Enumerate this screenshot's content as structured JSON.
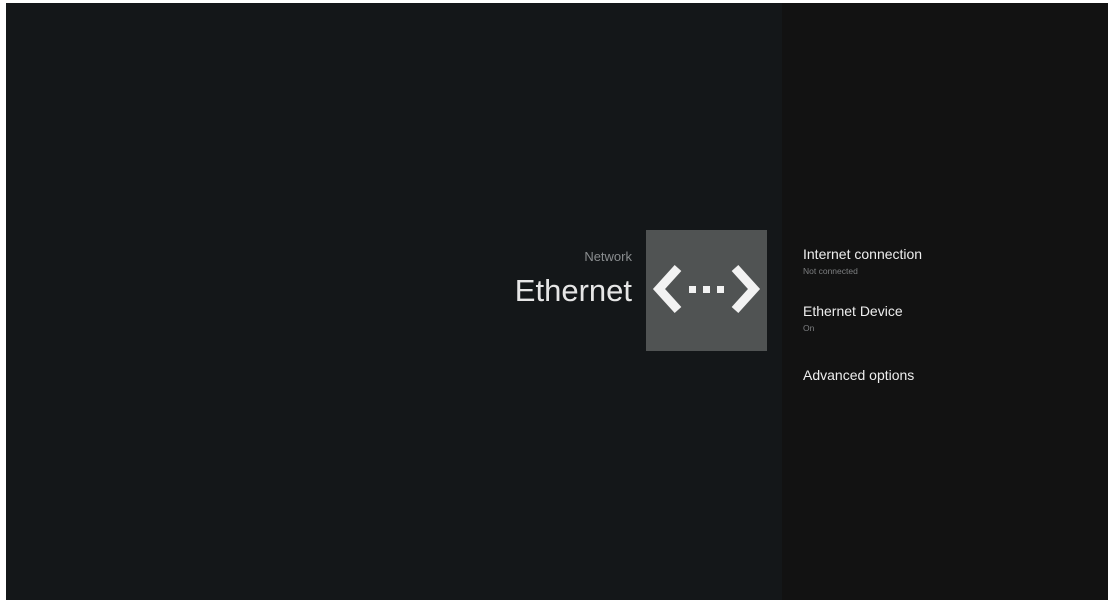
{
  "header": {
    "breadcrumb": "Network",
    "title": "Ethernet",
    "icon": "ethernet-icon"
  },
  "colors": {
    "background": "#141719",
    "panel": "#121212",
    "icon_tile": "#505353",
    "title_text": "#e6e6e6",
    "secondary_text": "#8a8d8f"
  },
  "menu": {
    "items": [
      {
        "title": "Internet connection",
        "subtitle": "Not connected"
      },
      {
        "title": "Ethernet Device",
        "subtitle": "On"
      },
      {
        "title": "Advanced options"
      }
    ]
  }
}
